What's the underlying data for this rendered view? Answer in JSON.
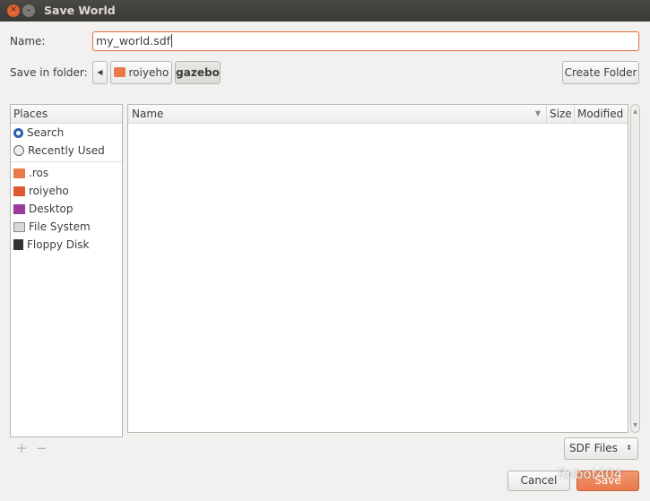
{
  "window": {
    "title": "Save World"
  },
  "name_field": {
    "label": "Name:",
    "value": "my_world.sdf"
  },
  "folder": {
    "label": "Save in folder:",
    "path": [
      {
        "label": "roiyeho",
        "icon": "home-folder-icon"
      },
      {
        "label": "gazebo",
        "icon": ""
      }
    ],
    "create_folder": "Create Folder"
  },
  "places": {
    "header": "Places",
    "items": [
      {
        "label": "Search",
        "icon": "search-icon"
      },
      {
        "label": "Recently Used",
        "icon": "clock-icon"
      },
      {
        "label": ".ros",
        "icon": "folder-icon"
      },
      {
        "label": "roiyeho",
        "icon": "home-folder-icon"
      },
      {
        "label": "Desktop",
        "icon": "desktop-icon"
      },
      {
        "label": "File System",
        "icon": "drive-icon"
      },
      {
        "label": "Floppy Disk",
        "icon": "floppy-icon"
      }
    ]
  },
  "files": {
    "columns": [
      "Name",
      "Size",
      "Modified"
    ],
    "rows": []
  },
  "filter": {
    "selected": "SDF Files"
  },
  "actions": {
    "cancel": "Cancel",
    "save": "Save",
    "add": "+",
    "remove": "−"
  },
  "watermark": "Robot404",
  "colors": {
    "accent": "#e9794a",
    "titlebar": "#3c3b37"
  }
}
